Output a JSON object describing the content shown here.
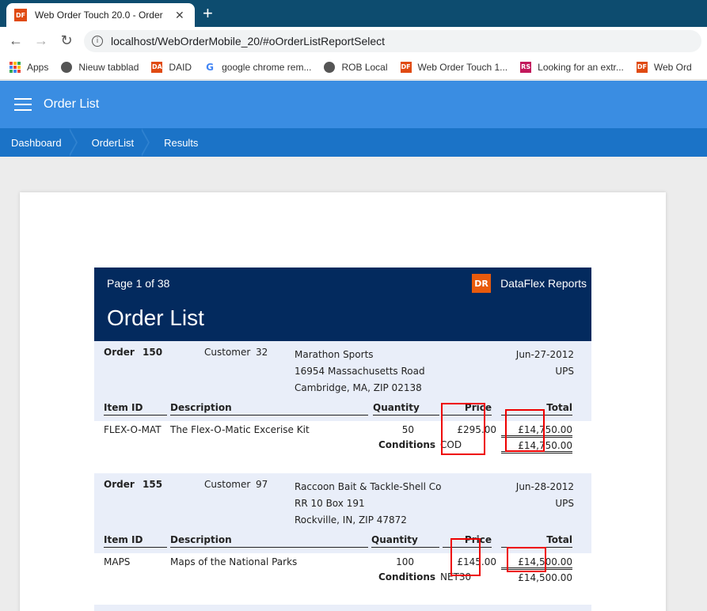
{
  "browser": {
    "tab_title": "Web Order Touch 20.0 - Order List",
    "favicon_text": "DF",
    "close": "✕",
    "new_tab": "+",
    "url": "localhost/WebOrderMobile_20/#oOrderListReportSelect",
    "bookmarks": [
      {
        "label": "Apps",
        "icon": "apps"
      },
      {
        "label": "Nieuw tabblad",
        "icon": "globe"
      },
      {
        "label": "DAID",
        "icon": "DA"
      },
      {
        "label": "google chrome rem...",
        "icon": "G"
      },
      {
        "label": "ROB Local",
        "icon": "globe"
      },
      {
        "label": "Web Order Touch 1...",
        "icon": "DF"
      },
      {
        "label": "Looking for an extr...",
        "icon": "RS"
      },
      {
        "label": "Web Ord",
        "icon": "DF"
      }
    ]
  },
  "app": {
    "title": "Order List",
    "breadcrumbs": [
      "Dashboard",
      "OrderList",
      "Results"
    ]
  },
  "report": {
    "page_info": "Page 1 of 38",
    "brand": "DataFlex Reports",
    "brand_logo": "DR",
    "title": "Order List",
    "labels": {
      "order": "Order",
      "customer": "Customer",
      "item_id": "Item ID",
      "description": "Description",
      "quantity": "Quantity",
      "price": "Price",
      "total": "Total",
      "conditions": "Conditions"
    },
    "orders": [
      {
        "number": "150",
        "customer_no": "32",
        "name": "Marathon Sports",
        "street": "16954 Massachusetts Road",
        "city": "Cambridge, MA, ZIP 02138",
        "date": "Jun-27-2012",
        "ship": "UPS",
        "item_id": "FLEX-O-MAT",
        "description": "The Flex-O-Matic Excerise Kit",
        "quantity": "50",
        "price": "£295.00",
        "line_total": "£14,750.00",
        "conditions": "COD",
        "order_total": "£14,750.00"
      },
      {
        "number": "155",
        "customer_no": "97",
        "name": "Raccoon Bait & Tackle-Shell Co",
        "street": "RR 10 Box 191",
        "city": "Rockville, IN, ZIP 47872",
        "date": "Jun-28-2012",
        "ship": "UPS",
        "item_id": "MAPS",
        "description": "Maps of the National Parks",
        "quantity": "100",
        "price": "£145.00",
        "line_total": "£14,500.00",
        "conditions": "NET30",
        "order_total": "£14,500.00"
      }
    ]
  },
  "colors": {
    "tabstrip": "#0d4c6f",
    "appbar": "#3a8de2",
    "breadcrumb": "#1b73c7",
    "report_header": "#032a5e",
    "order_band": "#e9eef9",
    "highlight": "#e00000"
  }
}
